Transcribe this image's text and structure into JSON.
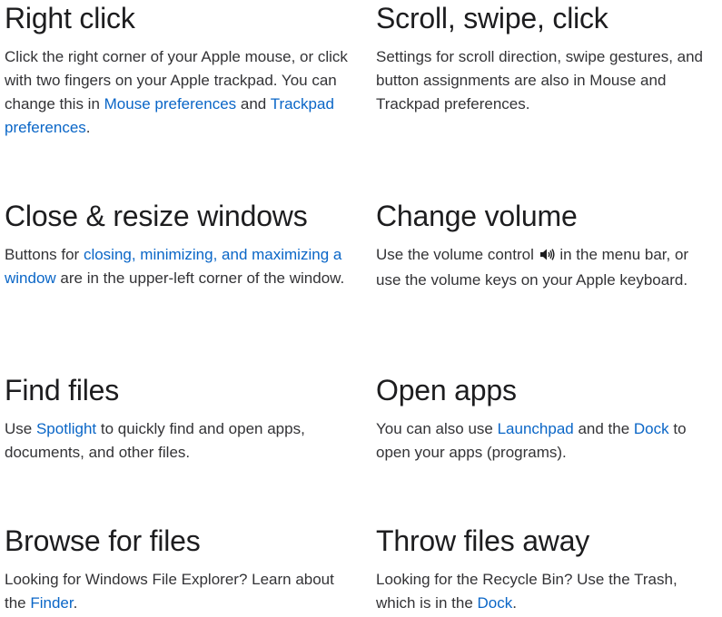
{
  "tiles": {
    "right_click": {
      "title": "Right click",
      "text1": "Click the right corner of your Apple mouse, or click with two fingers on your Apple trackpad. You can change this in ",
      "link1": "Mouse preferences",
      "text2": " and ",
      "link2": "Trackpad preferences",
      "text3": "."
    },
    "scroll": {
      "title": "Scroll, swipe, click",
      "text1": "Settings for scroll direction, swipe gestures, and button assignments are also in Mouse and Trackpad preferences."
    },
    "close_resize": {
      "title": "Close & resize windows",
      "text1": "Buttons for ",
      "link1": "closing, minimizing, and maximizing a window",
      "text2": " are in the upper-left corner of the window."
    },
    "volume": {
      "title": "Change volume",
      "text1": "Use the volume control ",
      "icon": "speaker-volume-icon",
      "text2": " in the menu bar, or use the volume keys on your Apple keyboard."
    },
    "find_files": {
      "title": "Find files",
      "text1": "Use ",
      "link1": "Spotlight",
      "text2": " to quickly find and open apps, documents, and other files."
    },
    "open_apps": {
      "title": "Open apps",
      "text1": "You can also use ",
      "link1": "Launchpad",
      "text2": " and the ",
      "link2": "Dock",
      "text3": " to open your apps (programs)."
    },
    "browse_files": {
      "title": "Browse for files",
      "text1": "Looking for Windows File Explorer? Learn about the ",
      "link1": "Finder",
      "text2": "."
    },
    "throw_away": {
      "title": "Throw files away",
      "text1": "Looking for the Recycle Bin? Use the Trash, which is in the ",
      "link1": "Dock",
      "text2": "."
    }
  },
  "colors": {
    "heading": "#1d1d1f",
    "body": "#333336",
    "link": "#0a66c7",
    "background": "#ffffff"
  }
}
